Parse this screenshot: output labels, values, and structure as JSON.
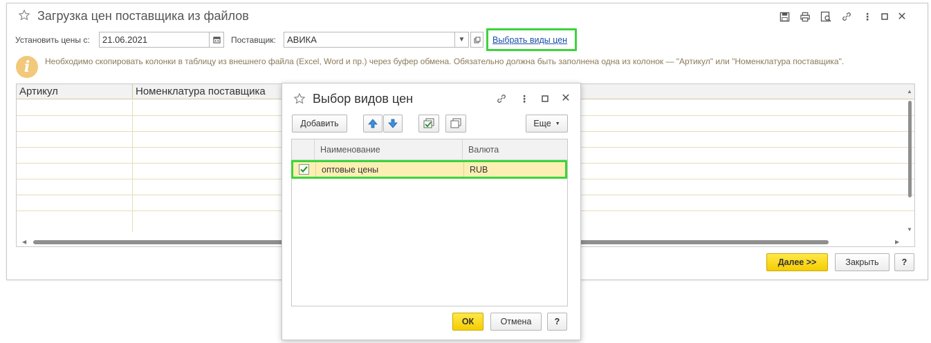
{
  "main": {
    "title": "Загрузка цен поставщика из файлов",
    "set_prices_label": "Установить цены с:",
    "date_value": "21.06.2021",
    "supplier_label": "Поставщик:",
    "supplier_value": "АВИКА",
    "select_price_types_link": "Выбрать виды цен",
    "info_text": "Необходимо скопировать колонки в таблицу из внешнего файла (Excel, Word и пр.) через буфер обмена. Обязательно должна быть заполнена одна из колонок — \"Артикул\" или \"Номенклатура поставщика\".",
    "table": {
      "columns": [
        "Артикул",
        "Номенклатура поставщика"
      ]
    },
    "buttons": {
      "next": "Далее >>",
      "close": "Закрыть",
      "help": "?"
    }
  },
  "dialog": {
    "title": "Выбор видов цен",
    "toolbar": {
      "add": "Добавить",
      "more": "Еще"
    },
    "table": {
      "columns": [
        "Наименование",
        "Валюта"
      ],
      "rows": [
        {
          "checked": true,
          "name": "оптовые цены",
          "currency": "RUB"
        }
      ]
    },
    "buttons": {
      "ok": "ОК",
      "cancel": "Отмена",
      "help": "?"
    }
  },
  "colors": {
    "highlight_green": "#3bd43b",
    "primary_yellow": "#f5cd00",
    "selected_row": "#fcefb4",
    "link_blue": "#1a4fa8"
  }
}
